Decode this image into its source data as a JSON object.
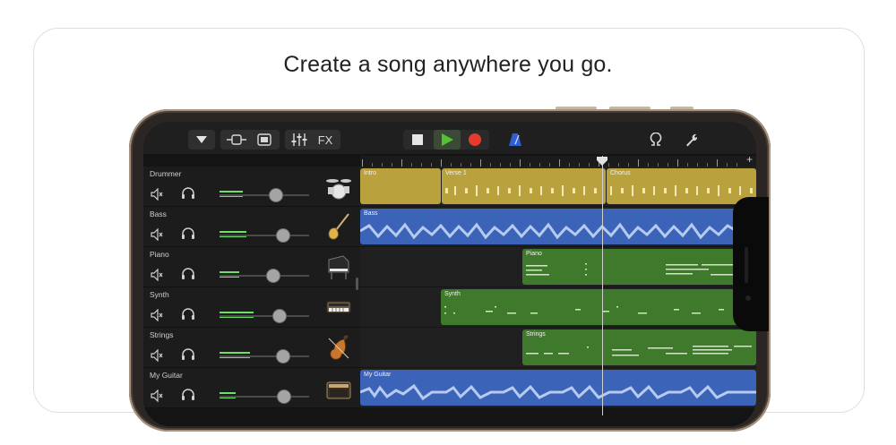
{
  "headline": "Create a song anywhere you go.",
  "toolbar": {
    "fx_label": "FX"
  },
  "colors": {
    "drummer": "#b9a23e",
    "audio": "#3b63b8",
    "midi": "#3f7a2c",
    "level": "#6ee06a",
    "record": "#e53b2f",
    "play": "#52c234"
  },
  "tracks": [
    {
      "name": "Drummer",
      "instrument": "drum-kit-icon",
      "volume": 0.6
    },
    {
      "name": "Bass",
      "instrument": "bass-guitar-icon",
      "volume": 0.7
    },
    {
      "name": "Piano",
      "instrument": "piano-icon",
      "volume": 0.55
    },
    {
      "name": "Synth",
      "instrument": "synth-keyboard-icon",
      "volume": 0.65
    },
    {
      "name": "Strings",
      "instrument": "violin-icon",
      "volume": 0.7
    },
    {
      "name": "My Guitar",
      "instrument": "amp-icon",
      "volume": 0.72
    }
  ],
  "regions": {
    "drummer": [
      "Intro",
      "Verse 1",
      "Chorus"
    ],
    "bass": "Bass",
    "piano": "Piano",
    "synth": "Synth",
    "strings": "Strings",
    "guitar": "My Guitar"
  }
}
